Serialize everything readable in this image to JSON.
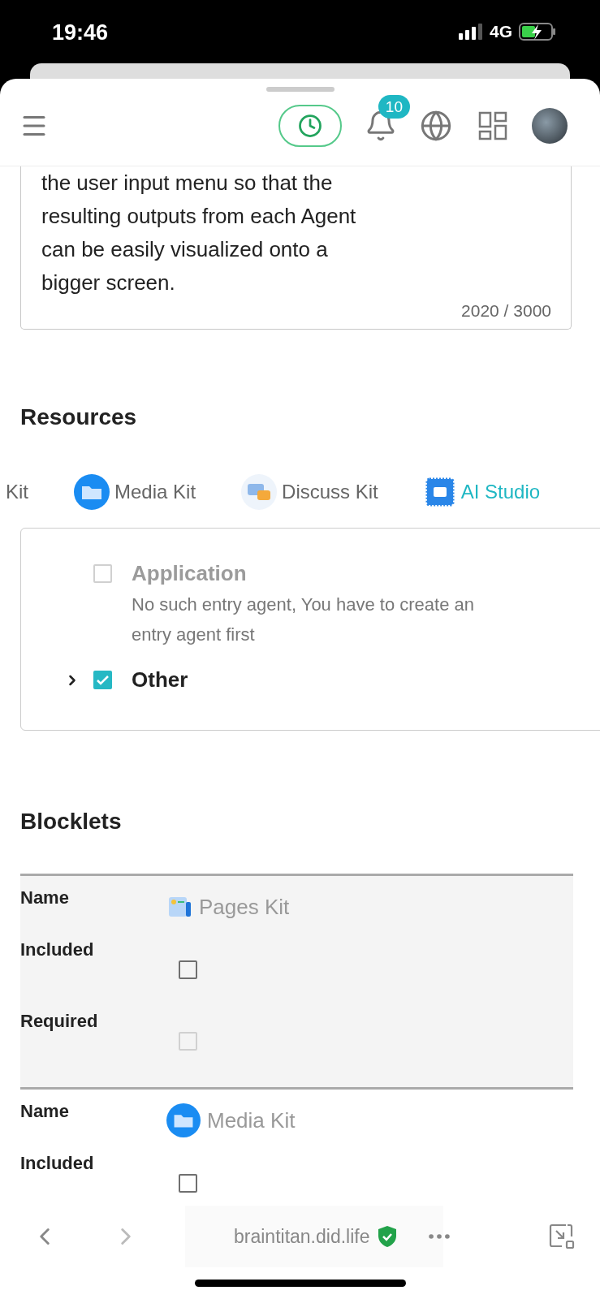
{
  "status_bar": {
    "time": "19:46",
    "network": "4G"
  },
  "header": {
    "notification_count": "10"
  },
  "description": {
    "lines": [
      "the user input menu so that the",
      "resulting outputs from each Agent",
      "can be easily visualized onto a",
      "bigger screen."
    ],
    "counter": "2020 / 3000"
  },
  "resources": {
    "title": "Resources",
    "tabs": [
      {
        "label": "Kit",
        "kind": "hidden",
        "selected": false
      },
      {
        "label": "Media Kit",
        "kind": "folder",
        "selected": false
      },
      {
        "label": "Discuss Kit",
        "kind": "chat",
        "selected": false
      },
      {
        "label": "AI Studio",
        "kind": "chip",
        "selected": true
      }
    ],
    "options": [
      {
        "label": "Application",
        "description": "No such entry agent, You have to create an entry agent first",
        "checked": false,
        "disabled": true,
        "has_children": false
      },
      {
        "label": "Other",
        "checked": true,
        "disabled": false,
        "has_children": true
      }
    ]
  },
  "blocklets": {
    "title": "Blocklets",
    "items": [
      {
        "fields": [
          {
            "label": "Name",
            "kind": "name",
            "value": "Pages Kit"
          },
          {
            "label": "Included",
            "kind": "checkbox",
            "checked": false,
            "disabled": false
          },
          {
            "label": "Required",
            "kind": "checkbox",
            "checked": false,
            "disabled": true
          }
        ]
      },
      {
        "fields": [
          {
            "label": "Name",
            "kind": "name",
            "value": "Media Kit"
          },
          {
            "label": "Included",
            "kind": "checkbox",
            "checked": false,
            "disabled": false
          }
        ]
      }
    ]
  },
  "browser": {
    "url": "braintitan.did.life"
  }
}
